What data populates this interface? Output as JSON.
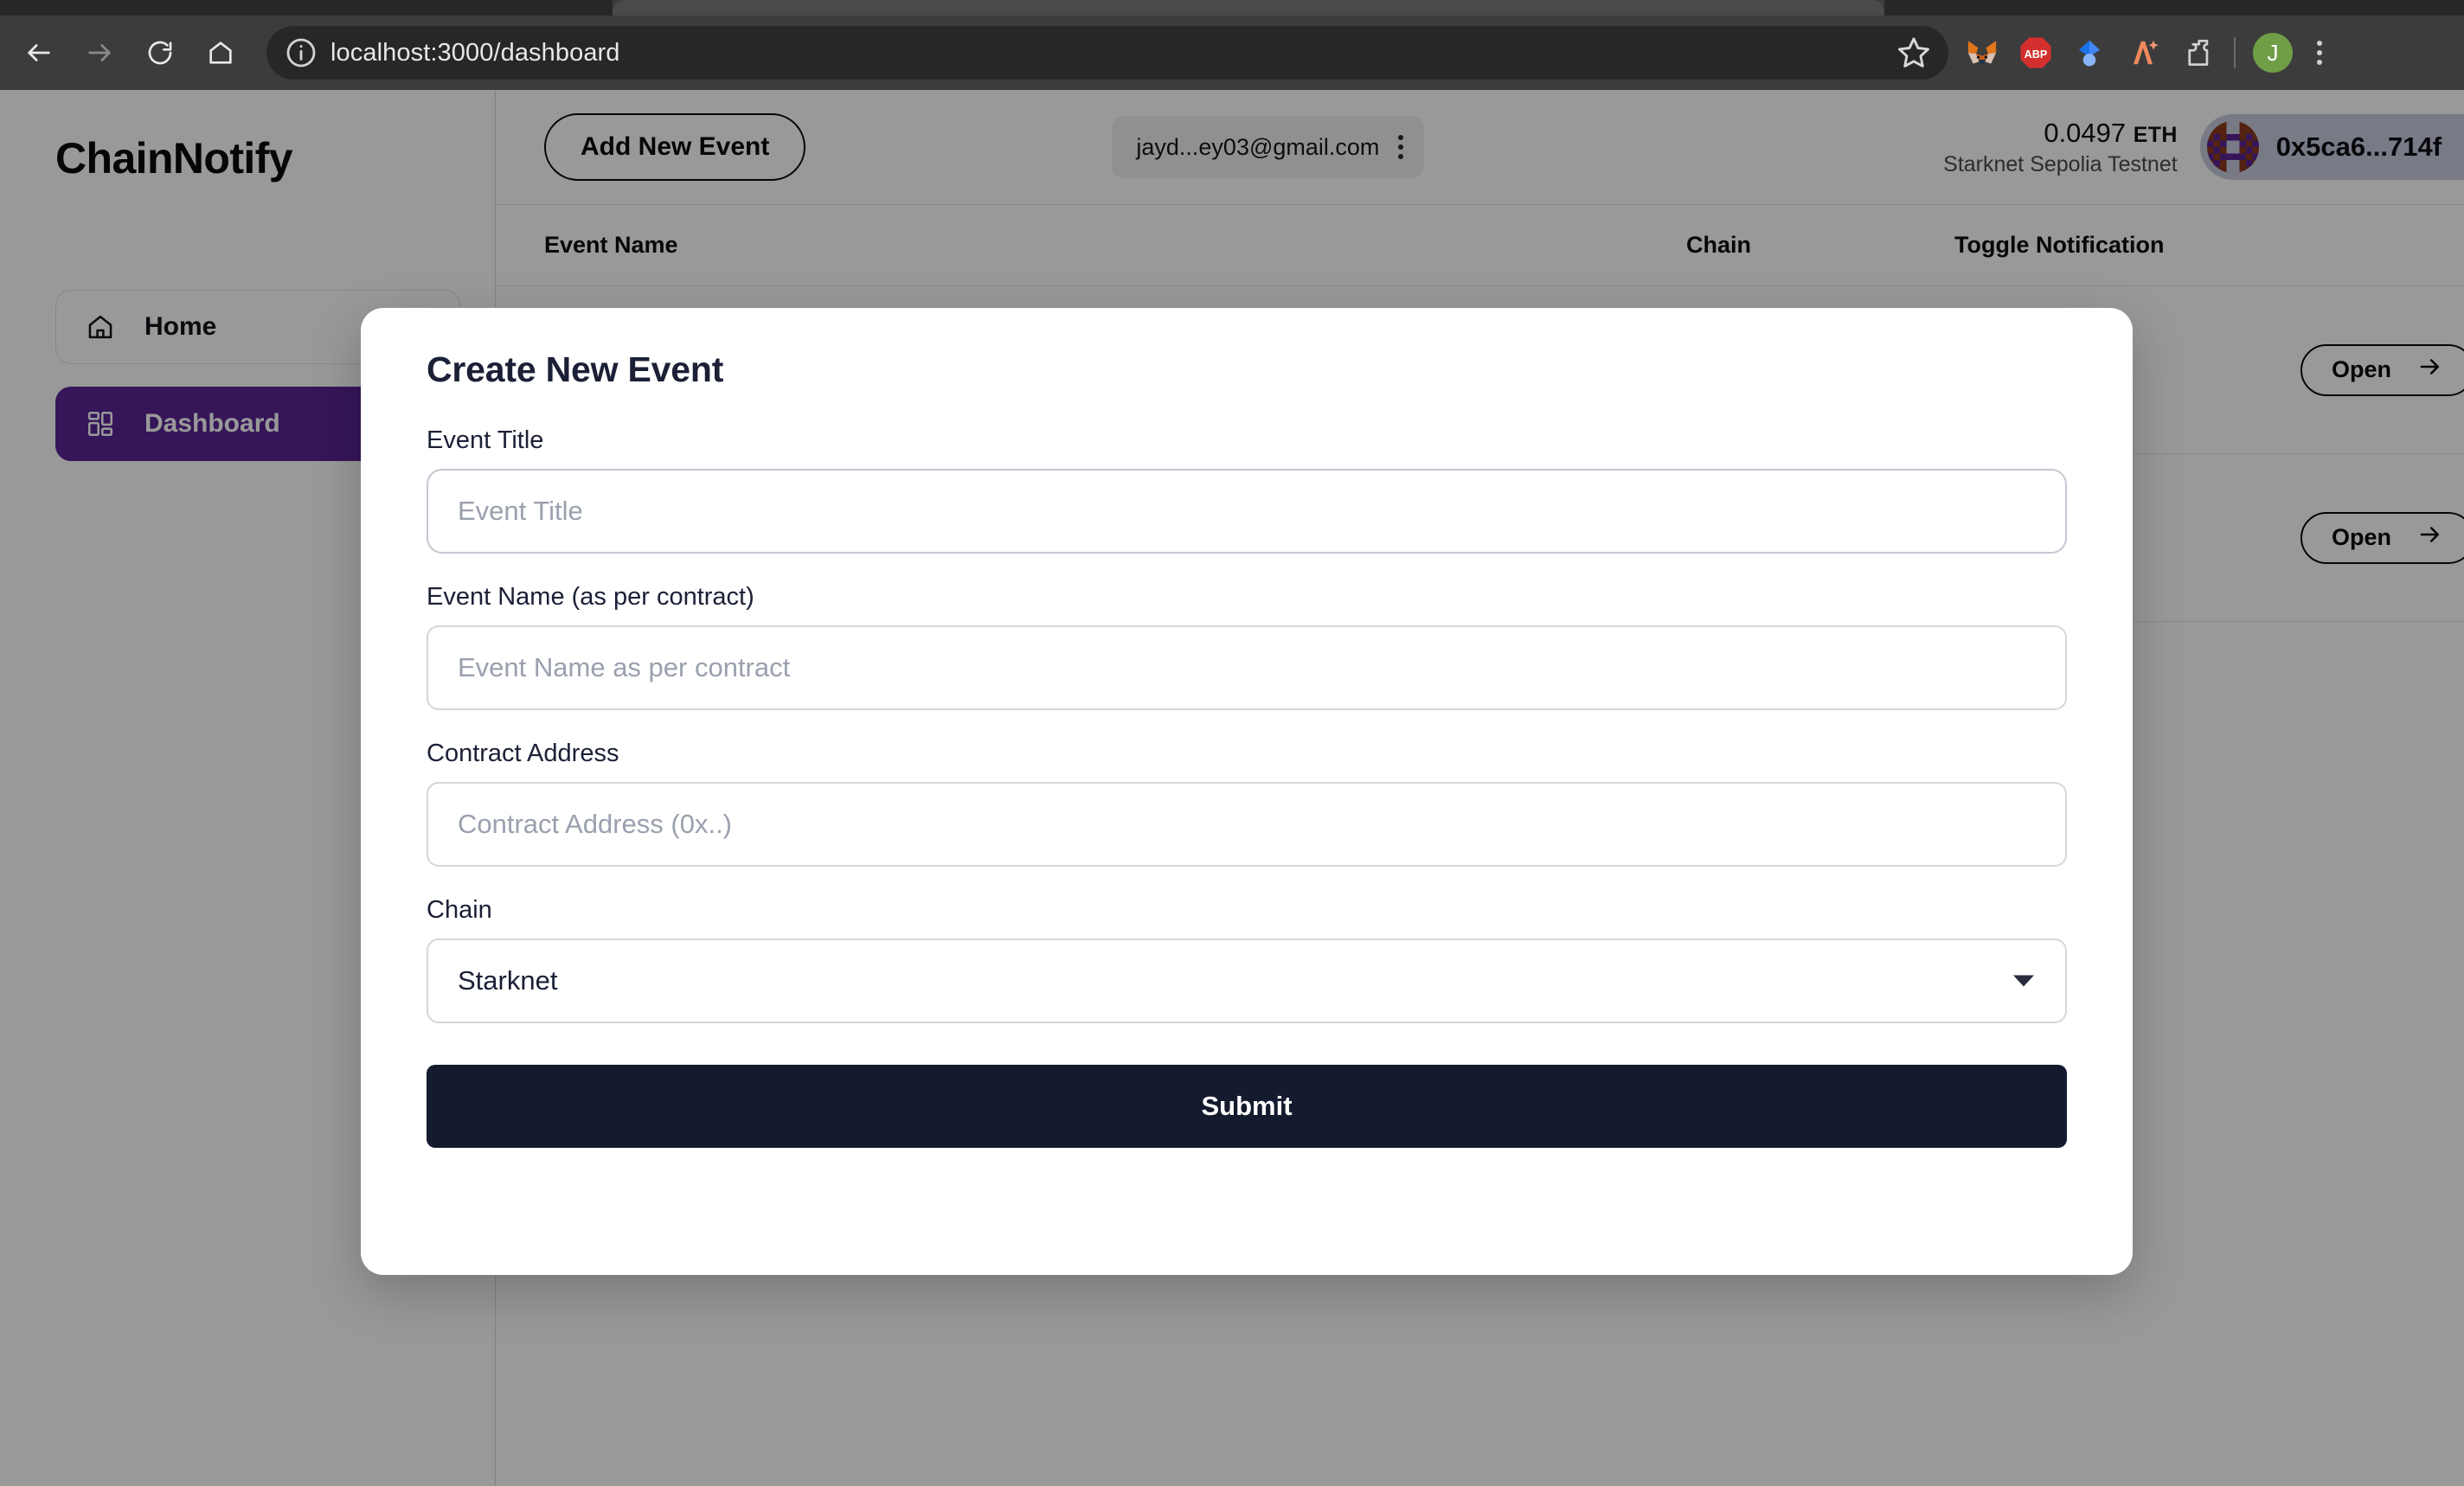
{
  "browser": {
    "url": "localhost:3000/dashboard",
    "back_icon": "back-arrow-icon",
    "forward_icon": "forward-arrow-icon",
    "reload_icon": "reload-icon",
    "home_icon": "home-icon",
    "site_info_icon": "site-info-icon",
    "bookmark_icon": "star-icon",
    "extensions": [
      {
        "name": "metamask-extension-icon",
        "label": ""
      },
      {
        "name": "adblock-plus-extension-icon",
        "label": "ABP"
      },
      {
        "name": "blue-diamond-extension-icon",
        "label": ""
      },
      {
        "name": "orange-ai-extension-icon",
        "label": ""
      },
      {
        "name": "extensions-puzzle-icon",
        "label": ""
      }
    ],
    "profile_initial": "J",
    "menu_icon": "three-dot-menu-icon"
  },
  "sidebar": {
    "logo": "ChainNotify",
    "items": [
      {
        "label": "Home",
        "icon": "home-icon",
        "active": false
      },
      {
        "label": "Dashboard",
        "icon": "grid-dashboard-icon",
        "active": true
      }
    ]
  },
  "topbar": {
    "add_event_label": "Add New Event",
    "account_email": "jayd...ey03@gmail.com",
    "account_menu_icon": "vertical-three-dot-icon",
    "balance_amount": "0.0497",
    "balance_unit": "ETH",
    "network": "Starknet Sepolia Testnet",
    "wallet_address": "0x5ca6...714f",
    "wallet_chevron_icon": "chevron-down-icon",
    "avatar_icon": "wallet-blockie-avatar"
  },
  "table": {
    "columns": [
      "Event Name",
      "Chain",
      "Toggle Notification"
    ],
    "rows": [
      {
        "open_label": "Open",
        "open_icon": "arrow-right-icon"
      },
      {
        "open_label": "Open",
        "open_icon": "arrow-right-icon"
      }
    ]
  },
  "modal": {
    "title": "Create New Event",
    "fields": [
      {
        "label": "Event Title",
        "placeholder": "Event Title",
        "value": "",
        "type": "text"
      },
      {
        "label": "Event Name (as per contract)",
        "placeholder": "Event Name as per contract",
        "value": "",
        "type": "text"
      },
      {
        "label": "Contract Address",
        "placeholder": "Contract Address (0x..)",
        "value": "",
        "type": "text"
      }
    ],
    "chain_label": "Chain",
    "chain_value": "Starknet",
    "chain_caret_icon": "chevron-down-icon",
    "submit_label": "Submit"
  },
  "colors": {
    "accent_purple": "#5b2494",
    "submit_navy": "#141b2e",
    "wallet_pill": "#c9cee0",
    "title_navy": "#1b2036"
  }
}
